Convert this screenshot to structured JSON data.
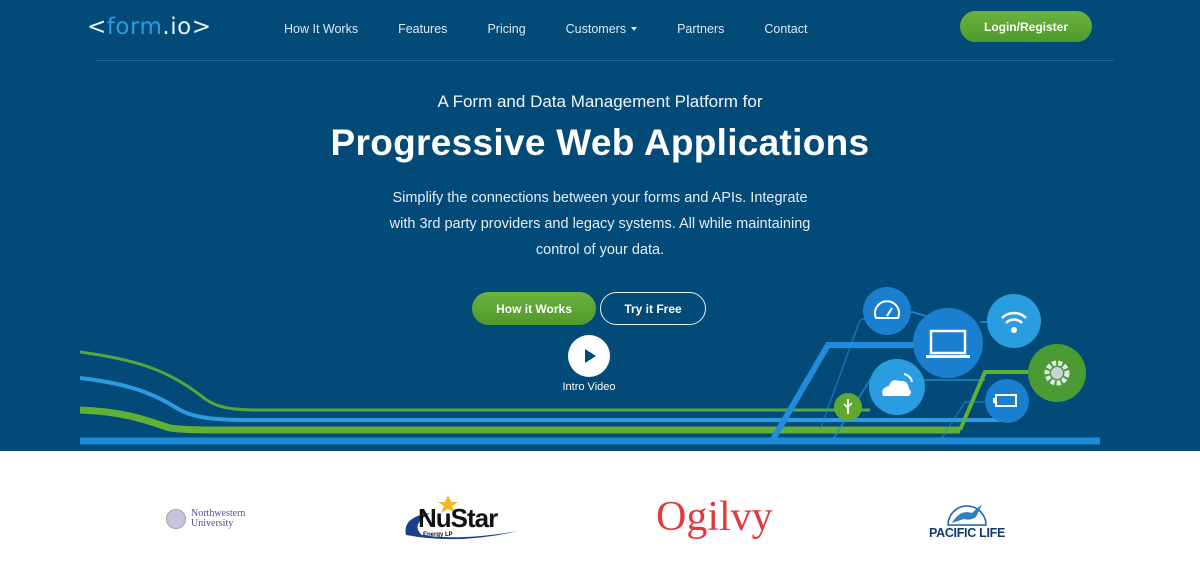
{
  "header": {
    "logo": {
      "left_bracket": "<",
      "form": "form",
      "io": ".io",
      "right_bracket": ">"
    },
    "nav": [
      {
        "label": "How It Works"
      },
      {
        "label": "Features"
      },
      {
        "label": "Pricing"
      },
      {
        "label": "Customers",
        "has_dropdown": true
      },
      {
        "label": "Partners"
      },
      {
        "label": "Contact"
      }
    ],
    "login_label": "Login/Register"
  },
  "hero": {
    "tagline": "A Form and Data Management Platform for",
    "headline": "Progressive Web Applications",
    "description": "Simplify the connections between your forms and APIs. Integrate with 3rd party providers and legacy systems. All while maintaining control of your data.",
    "primary_button": "How it Works",
    "secondary_button": "Try it Free",
    "video_label": "Intro Video",
    "illustration_icons": [
      "dashboard-gauge-icon",
      "laptop-icon",
      "wifi-icon",
      "gear-icon",
      "cloud-icon",
      "usb-icon",
      "battery-icon"
    ]
  },
  "customers": {
    "logos": [
      {
        "name": "Northwestern University",
        "line1": "Northwestern",
        "line2": "University"
      },
      {
        "name": "NuStar Energy LP",
        "main": "NuStar",
        "sub": "Energy LP"
      },
      {
        "name": "Ogilvy",
        "main": "Ogilvy"
      },
      {
        "name": "Pacific Life",
        "main": "PACIFIC LIFE"
      }
    ]
  },
  "colors": {
    "hero_bg": "#024a78",
    "accent_green": "#5fa834",
    "accent_blue": "#2a9de0",
    "ogilvy_red": "#e03a3e"
  }
}
